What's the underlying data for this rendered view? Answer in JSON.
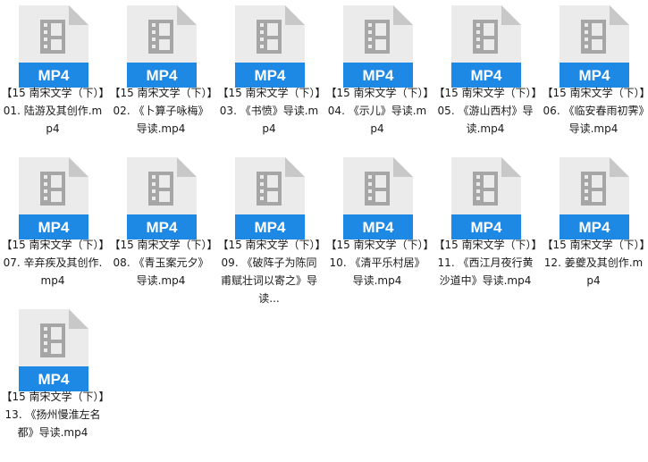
{
  "file_type_label": "MP4",
  "colors": {
    "page_fold": "#c8c8c8",
    "document": "#ebebeb",
    "film_icon": "#a6a6a6",
    "label_band": "#1e88e5",
    "label_text": "#ffffff"
  },
  "files": [
    {
      "name": "【15 南宋文学（下）】01. 陆游及其创作.mp4"
    },
    {
      "name": "【15 南宋文学（下）】02. 《卜算子咏梅》导读.mp4"
    },
    {
      "name": "【15 南宋文学（下）】03. 《书愤》导读.mp4"
    },
    {
      "name": "【15 南宋文学（下）】04. 《示儿》导读.mp4"
    },
    {
      "name": "【15 南宋文学（下）】05. 《游山西村》导读.mp4"
    },
    {
      "name": "【15 南宋文学（下）】06. 《临安春雨初霁》导读.mp4"
    },
    {
      "name": "【15 南宋文学（下）】07. 辛弃疾及其创作.mp4"
    },
    {
      "name": "【15 南宋文学（下）】08. 《青玉案元夕》导读.mp4"
    },
    {
      "name": "【15 南宋文学（下）】09. 《破阵子为陈同甫赋壮词以寄之》导读..."
    },
    {
      "name": "【15 南宋文学（下）】10. 《清平乐村居》导读.mp4"
    },
    {
      "name": "【15 南宋文学（下）】11. 《西江月夜行黄沙道中》导读.mp4"
    },
    {
      "name": "【15 南宋文学（下）】12. 姜夔及其创作.mp4"
    },
    {
      "name": "【15 南宋文学（下）】13. 《扬州慢淮左名都》导读.mp4"
    }
  ]
}
